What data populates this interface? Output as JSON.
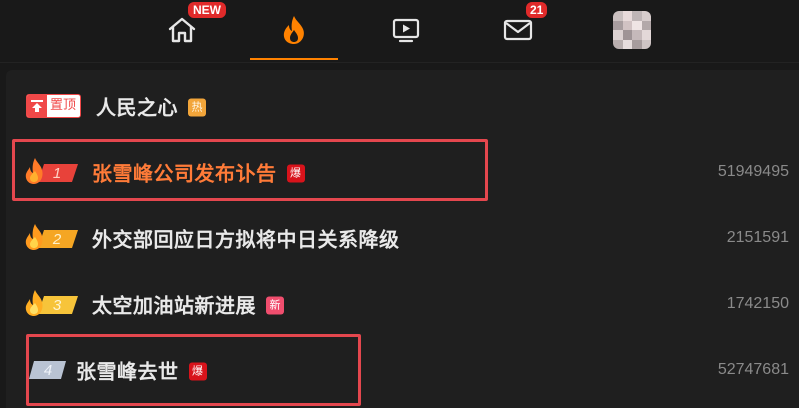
{
  "nav": {
    "home_badge": "NEW",
    "messages_badge": "21"
  },
  "hot_list": {
    "pinned": {
      "pin_label": "置顶",
      "title": "人民之心",
      "tag": "热"
    },
    "items": [
      {
        "rank": "1",
        "title": "张雪峰公司发布讣告",
        "tag": "爆",
        "count": "51949495"
      },
      {
        "rank": "2",
        "title": "外交部回应日方拟将中日关系降级",
        "tag": "",
        "count": "2151591"
      },
      {
        "rank": "3",
        "title": "太空加油站新进展",
        "tag": "新",
        "count": "1742150"
      },
      {
        "rank": "4",
        "title": "张雪峰去世",
        "tag": "爆",
        "count": "52747681"
      }
    ]
  },
  "colors": {
    "accent": "#ff8200",
    "highlight_title": "#ff7b38",
    "badge_red": "#e02a2a",
    "tag_hot": "#f2a53a",
    "tag_boom": "#d8131b",
    "tag_new": "#f04e6e",
    "annotation": "#e4474e"
  }
}
